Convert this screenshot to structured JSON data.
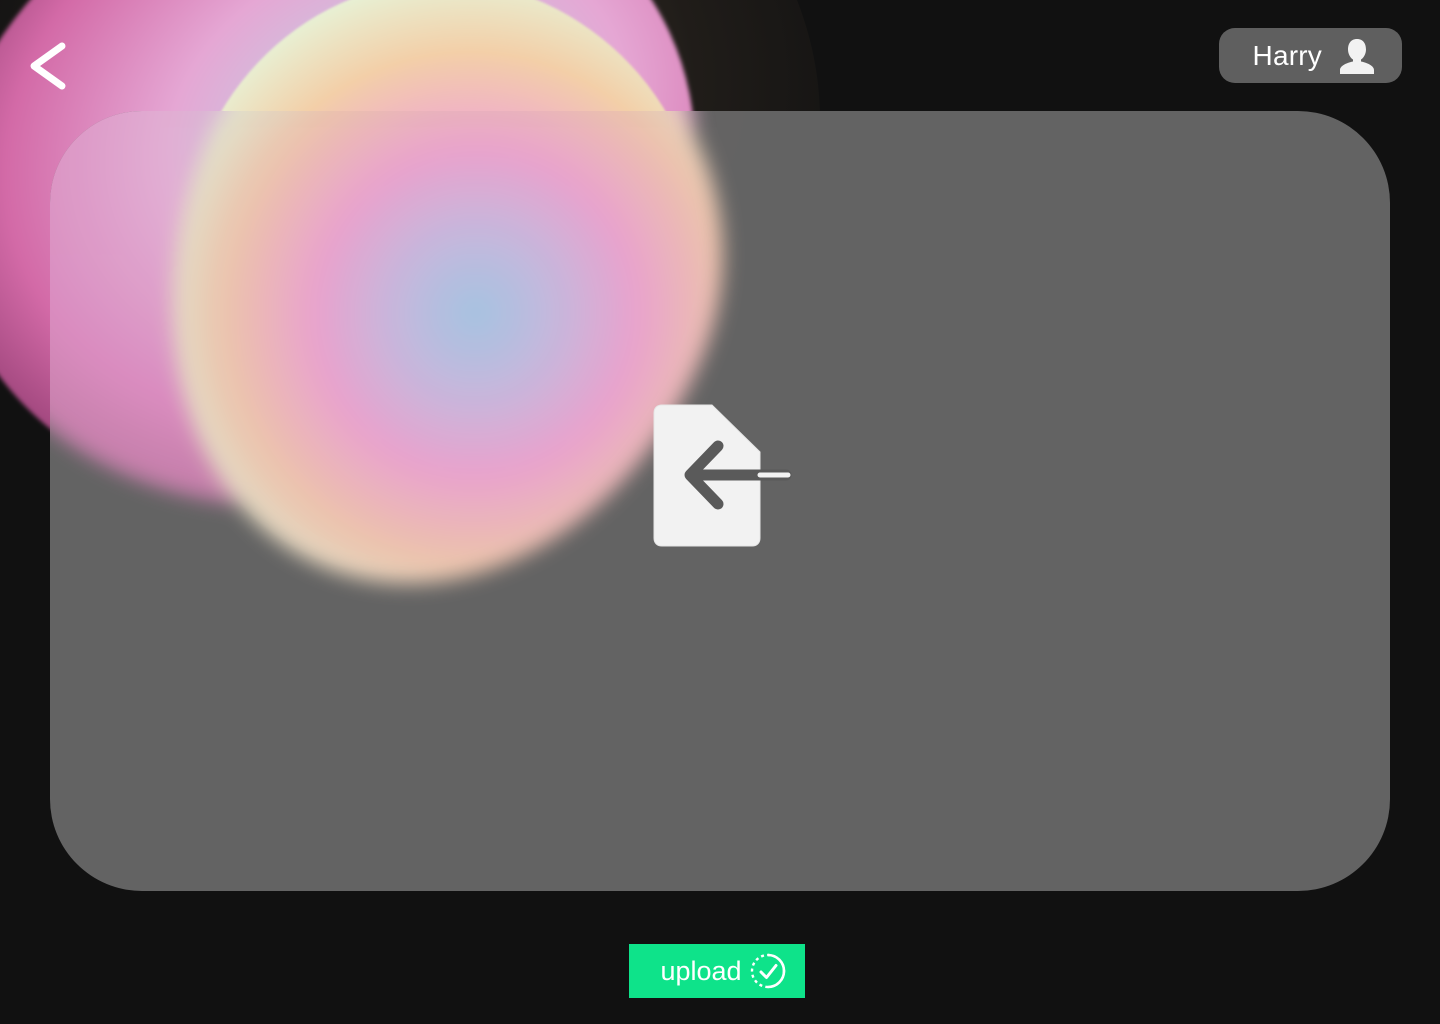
{
  "header": {
    "back_icon": "chevron-left-icon",
    "user": {
      "name": "Harry",
      "icon": "user-icon"
    }
  },
  "dropzone": {
    "icon": "file-import-icon"
  },
  "footer": {
    "upload_label": "upload",
    "upload_icon": "check-circle-dashed-icon"
  },
  "colors": {
    "background": "#111111",
    "panel": "#666666",
    "user_chip": "#5f5f5f",
    "accent": "#0ee38a",
    "icon_light": "#f2f2f2",
    "icon_dark": "#5a5a5a"
  }
}
